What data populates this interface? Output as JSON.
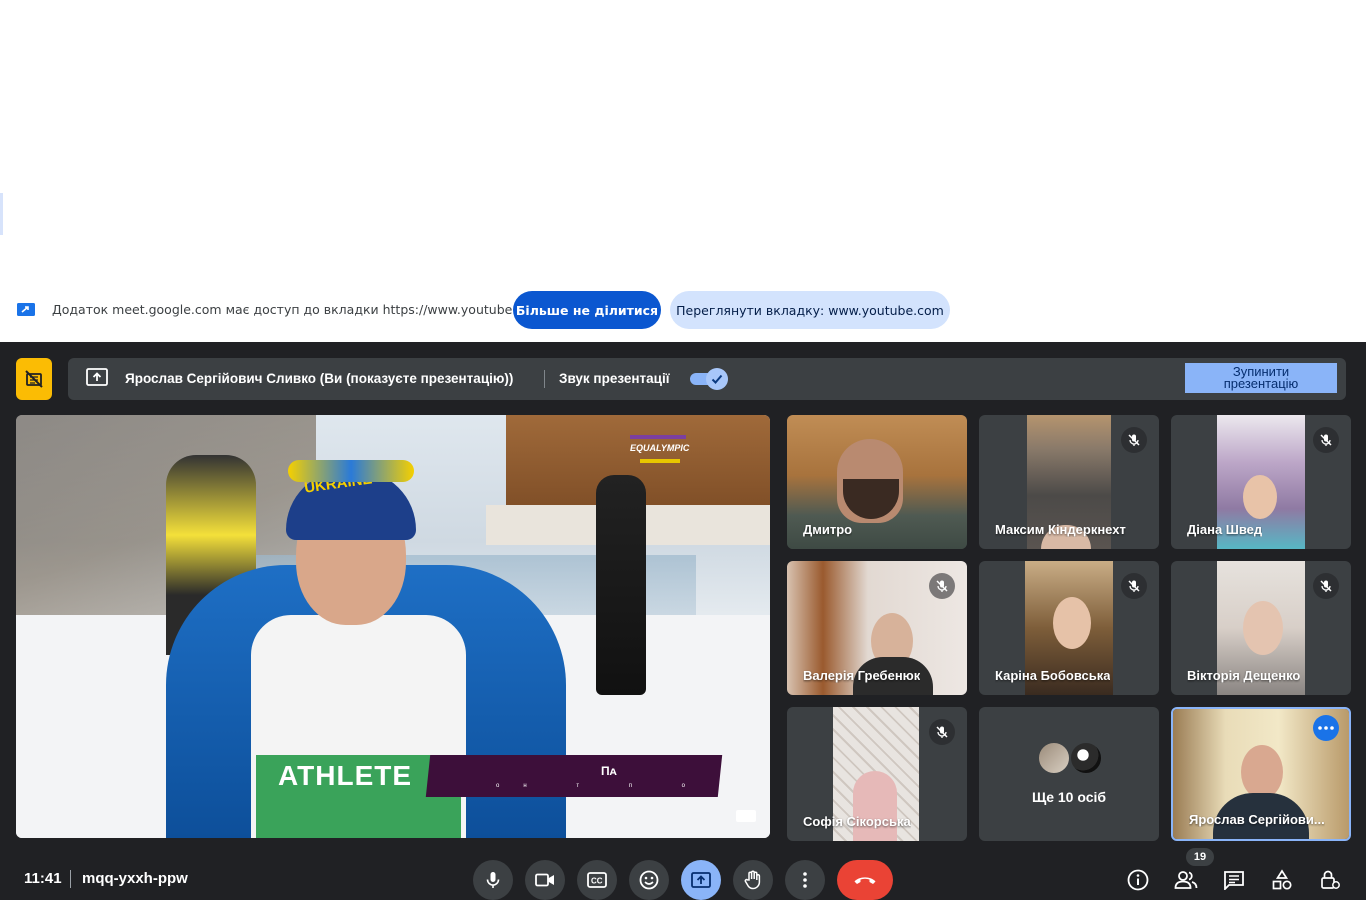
{
  "share_bar": {
    "message": "Додаток meet.google.com має доступ до вкладки https://www.youtube.com",
    "stop_sharing_label": "Більше не ділитися",
    "view_tab_label": "Переглянути вкладку: www.youtube.com"
  },
  "presentation_bar": {
    "presenter": "Ярослав Сергійович Сливко (Ви (показуєте презентацію))",
    "audio_label": "Звук презентації",
    "audio_enabled": true,
    "stop_label": "Зупинити презентацію"
  },
  "main_video": {
    "bib_text": "ATHLETE",
    "hat_text": "UKRAINE",
    "logo_text": "EQUALYMPIC",
    "banner_title": "Пᴀ",
    "banner_subtitle": "ᴏн т п о"
  },
  "participants": [
    {
      "name": "Дмитро",
      "muted": false
    },
    {
      "name": "Максим Кіндеркнехт",
      "muted": true
    },
    {
      "name": "Діана Швед",
      "muted": true
    },
    {
      "name": "Валерія Гребенюк",
      "muted": true
    },
    {
      "name": "Каріна Бобовська",
      "muted": true
    },
    {
      "name": "Вікторія Дещенко",
      "muted": true
    },
    {
      "name": "Софія Сікорська",
      "muted": true
    },
    {
      "name": "Ще 10 осіб",
      "muted": false
    },
    {
      "name": "Ярослав Сергійови...",
      "muted": false
    }
  ],
  "bottom_bar": {
    "time": "11:41",
    "meeting_code": "mqq-yxxh-ppw",
    "participant_count": "19"
  },
  "icons": [
    "share-tab-icon",
    "camera-off-icon",
    "present-icon",
    "check-icon",
    "mic-off-icon",
    "more-options-icon",
    "mic-icon",
    "camera-icon",
    "captions-icon",
    "emoji-icon",
    "present-screen-icon",
    "raise-hand-icon",
    "more-vert-icon",
    "end-call-icon",
    "info-icon",
    "people-icon",
    "chat-icon",
    "activities-icon",
    "host-controls-icon"
  ],
  "colors": {
    "accent": "#8ab4f8",
    "meet_bg": "#202124",
    "tile_bg": "#3c4043",
    "end_call": "#ea4335",
    "camera_off": "#fbbc04",
    "primary_button": "#0b57d0"
  }
}
